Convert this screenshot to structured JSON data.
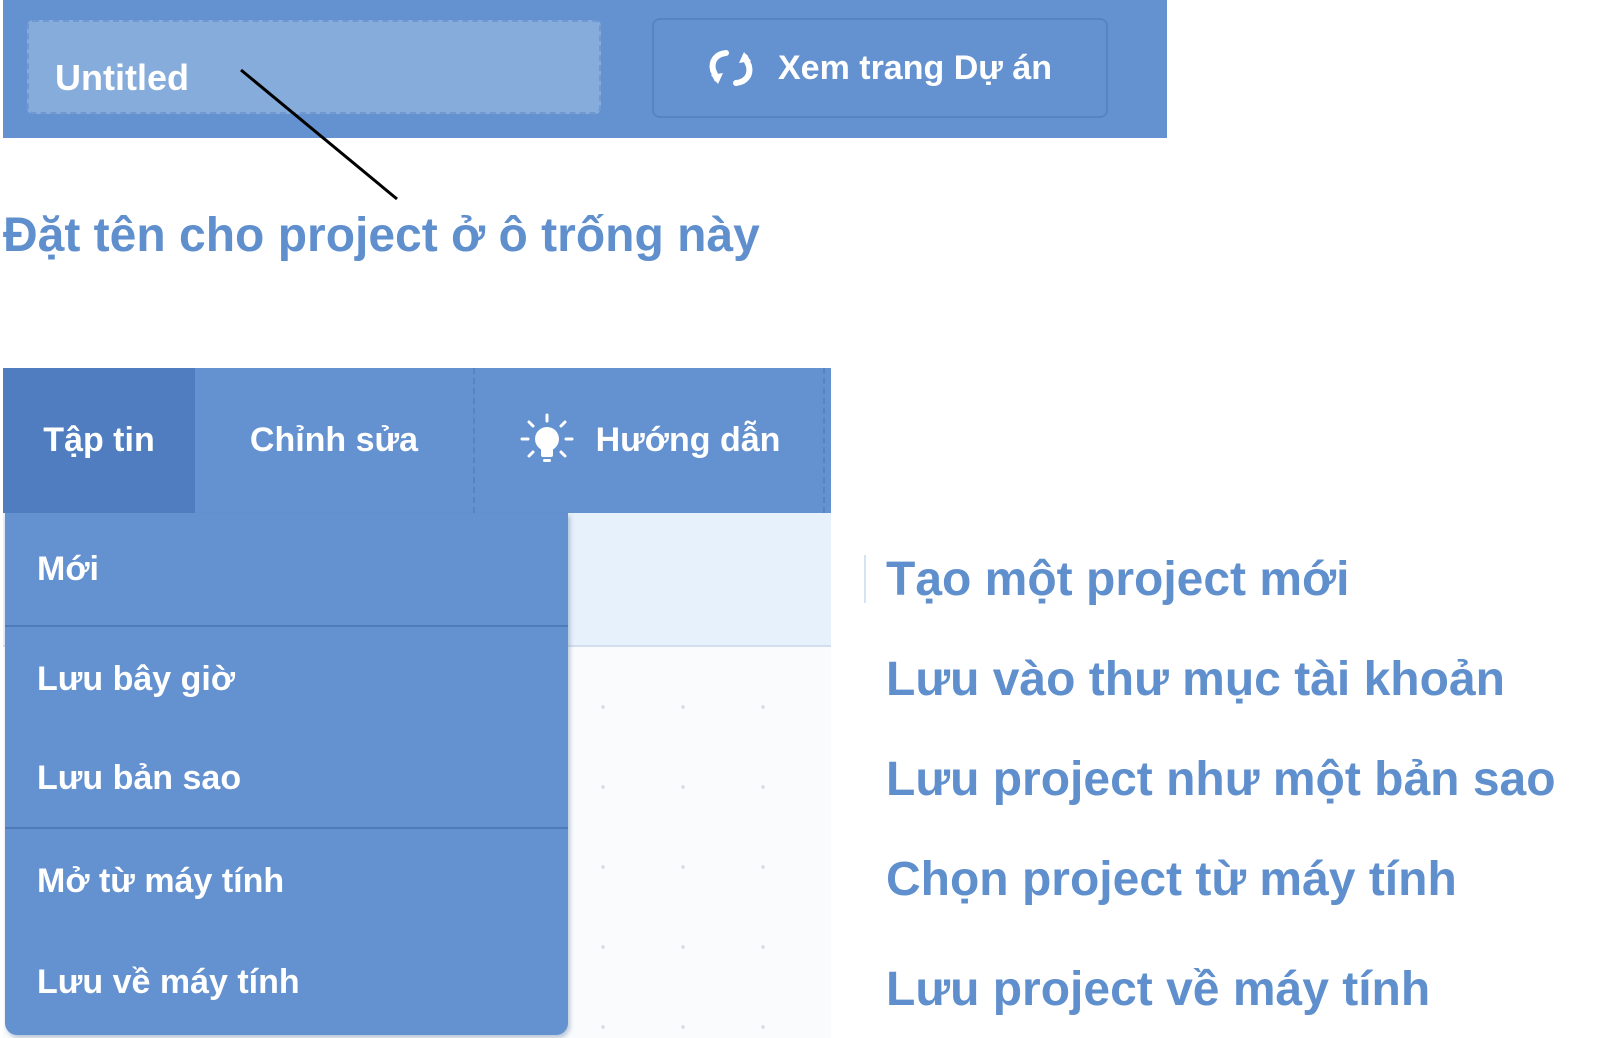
{
  "title_bar": {
    "project_title_value": "Untitled",
    "view_project_label": "Xem trang Dự án",
    "view_project_icon": "remix-arrows-icon",
    "background_color": "#6491cf"
  },
  "caption": "Đặt tên cho project ở ô trống này",
  "menu_bar": {
    "tabs": {
      "file": "Tập tin",
      "edit": "Chỉnh sửa",
      "tutorials": "Hướng dẫn"
    },
    "tutorials_icon": "lightbulb-icon",
    "active_tab": "file"
  },
  "file_menu": {
    "items": [
      {
        "label": "Mới"
      },
      {
        "label": "Lưu bây giờ"
      },
      {
        "label": "Lưu bản sao"
      },
      {
        "label": "Mở từ máy tính"
      },
      {
        "label": "Lưu về máy tính"
      }
    ]
  },
  "annotations": [
    "Tạo một project mới",
    "Lưu vào thư mục tài khoản",
    "Lưu project như một bản sao",
    "Chọn project từ máy tính",
    "Lưu project về máy tính"
  ],
  "colors": {
    "accent": "#5f8fcd",
    "menu_blue": "#6491cf",
    "active_tab": "#4f7dbf"
  }
}
